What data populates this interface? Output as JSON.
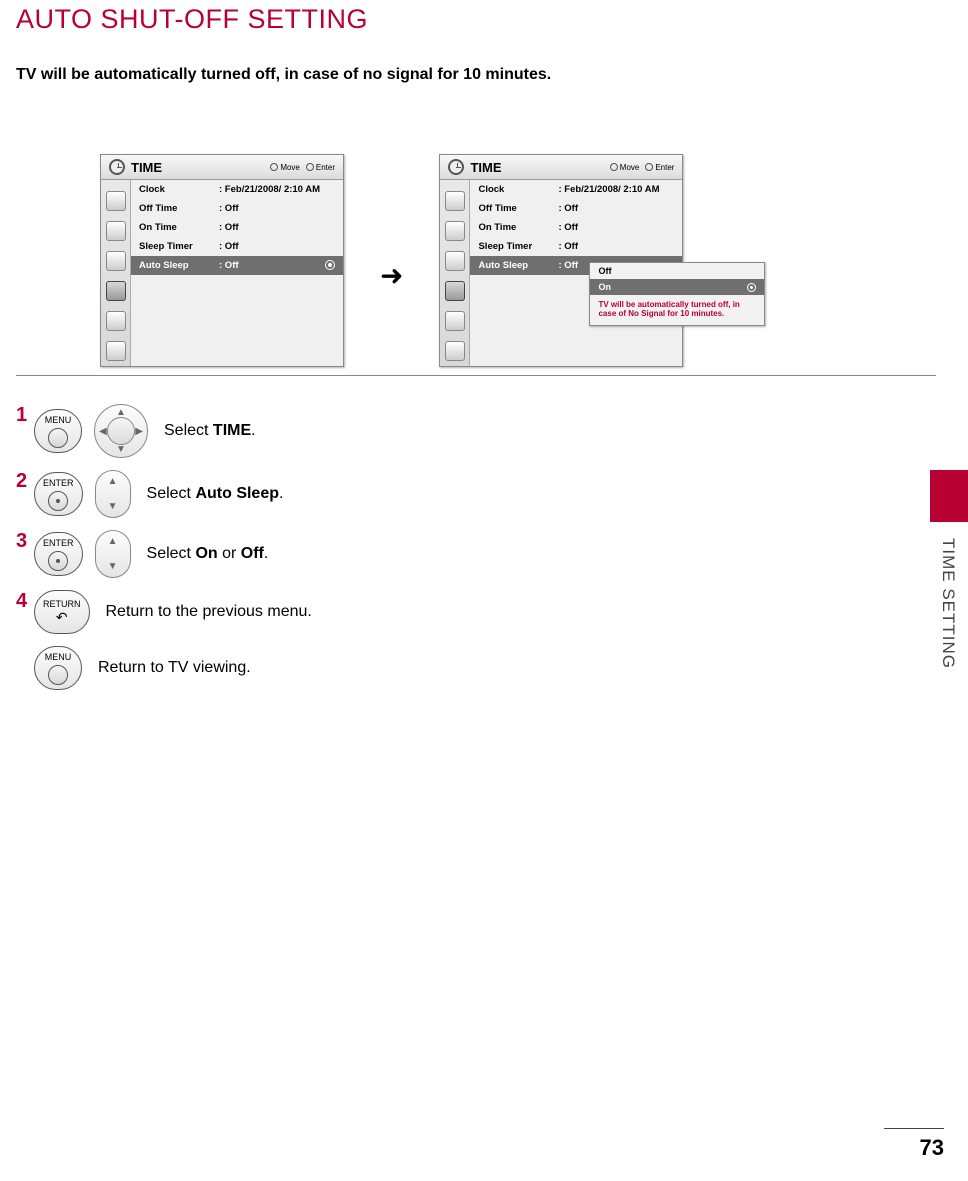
{
  "title": "AUTO SHUT-OFF SETTING",
  "subtitle": "TV will be automatically turned off, in case of no signal for 10 minutes.",
  "menu_header": "TIME",
  "hints": {
    "move": "Move",
    "enter": "Enter"
  },
  "rows": {
    "clock": {
      "label": "Clock",
      "value": ": Feb/21/2008/  2:10 AM"
    },
    "offtime": {
      "label": "Off Time",
      "value": ": Off"
    },
    "ontime": {
      "label": "On Time",
      "value": ": Off"
    },
    "sleep": {
      "label": "Sleep Timer",
      "value": ": Off"
    },
    "autosleep": {
      "label": "Auto Sleep",
      "value": ": Off"
    }
  },
  "popup": {
    "off": "Off",
    "on": "On",
    "note": "TV will be automatically turned off, in case of No Signal for 10 minutes."
  },
  "buttons": {
    "menu": "MENU",
    "enter": "ENTER",
    "return": "RETURN"
  },
  "steps": {
    "s1": {
      "num": "1",
      "pre": "Select ",
      "bold": "TIME",
      "post": "."
    },
    "s2": {
      "num": "2",
      "pre": "Select ",
      "bold": "Auto Sleep",
      "post": "."
    },
    "s3": {
      "num": "3",
      "pre": "Select ",
      "bold": "On",
      "mid": " or ",
      "bold2": "Off",
      "post": "."
    },
    "s4": {
      "num": "4",
      "text": "Return to the previous menu."
    },
    "s5": {
      "text": "Return to TV viewing."
    }
  },
  "side_label": "TIME SETTING",
  "page_num": "73"
}
